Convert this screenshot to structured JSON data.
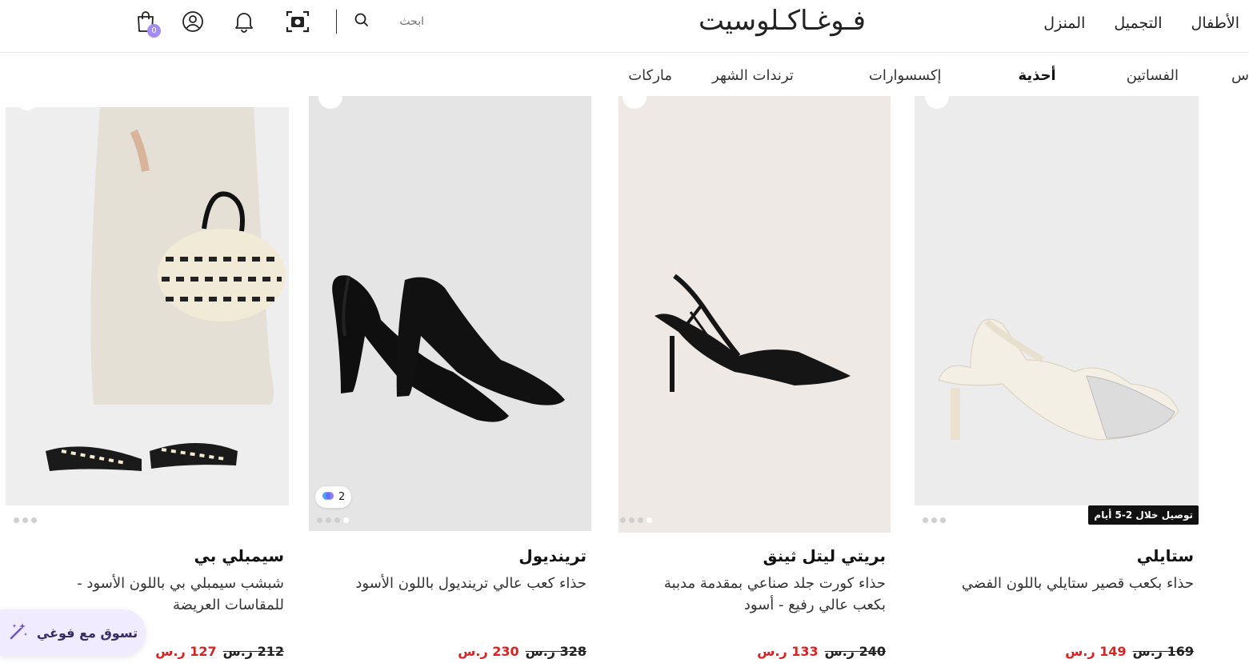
{
  "header": {
    "logo": "فـوغـاكـلوسيت",
    "nav": [
      "الأطفال",
      "التجميل",
      "المنزل"
    ],
    "search_placeholder": "ابحث",
    "cart_count": "0"
  },
  "categories": {
    "items": [
      "س",
      "الفساتين",
      "أحذية",
      "إكسسوارات",
      "ترندات الشهر",
      "ماركات"
    ],
    "active": "أحذية"
  },
  "products": [
    {
      "brand": "ستايلي",
      "name": "حذاء بكعب قصير ستايلي باللون الفضي",
      "old_price": "169",
      "new_price": "149",
      "badge": "توصيل خلال 2-5 أيام"
    },
    {
      "brand": "بريتي ليتل ثينق",
      "name": "حذاء كورت جلد صناعي بمقدمة مدببة بكعب عالي رفيع - أسود",
      "old_price": "240",
      "new_price": "133"
    },
    {
      "brand": "تريندیول",
      "name": "حذاء كعب عالي تريندیول باللون الأسود",
      "old_price": "328",
      "new_price": "230",
      "variants": "2"
    },
    {
      "brand": "سيمبلي بي",
      "name": "شبشب سيمبلي بي باللون الأسود - للمقاسات العريضة",
      "old_price": "212",
      "new_price": "127"
    }
  ],
  "currency_symbol": "ر.س",
  "assistant": {
    "label": "تسوق مع فوغي"
  }
}
